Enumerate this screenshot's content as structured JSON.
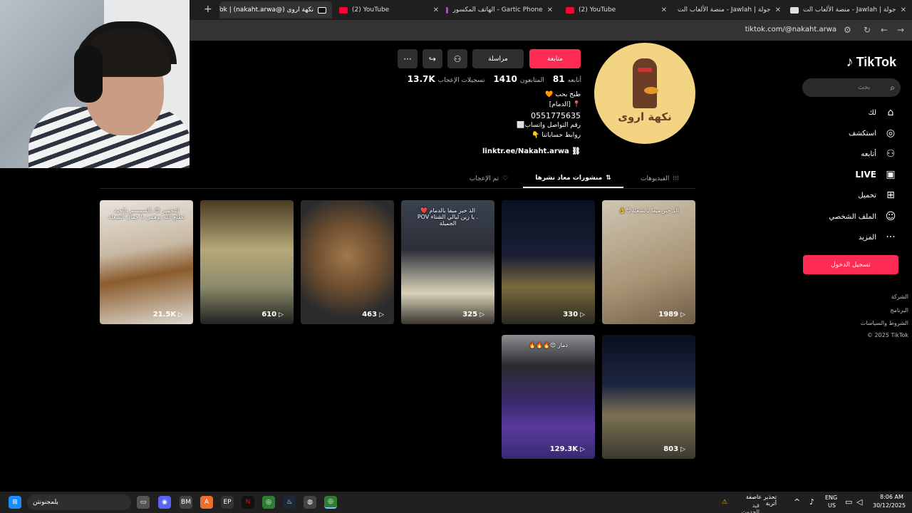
{
  "browser": {
    "tabs": [
      {
        "title": "جولة | Jawlah - منصة الألعاب الت",
        "favicon_color": "#e0e0e0"
      },
      {
        "title": "جولة | Jawlah - منصة الألعاب الت",
        "favicon_color": "#e0e0e0"
      },
      {
        "title": "(2) YouTube",
        "favicon_color": "#ff0033"
      },
      {
        "title": "Gartic Phone - الهاتف المكسور",
        "favicon_color": "#9b59b6"
      },
      {
        "title": "(2) YouTube",
        "favicon_color": "#ff0033"
      },
      {
        "title": "نكهة اروى (@nakaht.arwa) | Tok",
        "favicon_color": "#ffffff"
      }
    ],
    "new_tab": "+",
    "close_glyph": "✕",
    "url": "tiktok.com/@nakaht.arwa"
  },
  "sidebar": {
    "logo": "TikTok",
    "search_placeholder": "بحث",
    "nav": [
      {
        "label": "لك",
        "icon": "home-icon",
        "glyph": "⌂"
      },
      {
        "label": "استكشف",
        "icon": "compass-icon",
        "glyph": "◎"
      },
      {
        "label": "أتابعه",
        "icon": "following-icon",
        "glyph": "⚇"
      },
      {
        "label": "LIVE",
        "icon": "live-icon",
        "glyph": "▣"
      },
      {
        "label": "تحميل",
        "icon": "upload-icon",
        "glyph": "⊞"
      },
      {
        "label": "الملف الشخصي",
        "icon": "profile-icon",
        "glyph": "☺"
      },
      {
        "label": "المزيد",
        "icon": "more-icon",
        "glyph": "···"
      }
    ],
    "login": "تسجيل الدخول",
    "footer": [
      "الشركة",
      "البرنامج",
      "الشروط والسياسات",
      "© 2025 TikTok"
    ]
  },
  "profile": {
    "avatar_text": "نكهة اروى",
    "follow": "متابعة",
    "message": "مراسلة",
    "stats": [
      {
        "num": "81",
        "label": "أتابعه"
      },
      {
        "num": "1410",
        "label": "المتابعون"
      },
      {
        "num": "13.7K",
        "label": "تسجيلات الإعجاب"
      }
    ],
    "bio": [
      "طبخ بحب 🧡",
      "📍 [الدمام]",
      "0551775635",
      "رقم التواصل واتساب⬜",
      "روابط حساباتنا 👇"
    ],
    "link": "linktr.ee/Nakaht.arwa"
  },
  "tabs": [
    {
      "label": "الفيديوهات",
      "glyph": "⁝⁝⁝"
    },
    {
      "label": "منشورات معاد نشرها",
      "glyph": "⇅"
    },
    {
      "label": "تم الإعجاب",
      "glyph": "♡"
    }
  ],
  "videos": [
    {
      "views": "1989",
      "caption": "الذ خبز ميفا بالشعلة😍👌",
      "bg": "linear-gradient(160deg,#cfc6b3,#a89374 60%,#6e5d47)"
    },
    {
      "views": "330",
      "caption": "",
      "bg": "linear-gradient(180deg,#0b1022 0%,#1a1f36 45%,#7a6a3c 70%,#2a2a22)"
    },
    {
      "views": "325",
      "caption": "الذ خبز ميفا بالدمام ❤️\n. يا زين ليالي الشتاء POV\nالجميلة",
      "bg": "linear-gradient(180deg,#3a4250 0%,#2c2f38 40%,#d9d2b8 75%,#3a3530)"
    },
    {
      "views": "463",
      "caption": "",
      "bg": "radial-gradient(circle at 50% 45%,#a1784a 0%,#6d4e30 40%,#2b2b2b 75%)"
    },
    {
      "views": "610",
      "caption": "",
      "bg": "linear-gradient(180deg,#4a3b22 0%,#b7a878 40%,#8a8a6b 70%,#222)"
    },
    {
      "views": "21.5K",
      "caption": "التخمير 😍 بالسمسم والحبة\nتطلع الله يوهمي يا جمال الشعلة",
      "bg": "linear-gradient(170deg,#e8e3dc 0%,#c9b9a4 40%,#8a5c2e 60%,#e0dbd2)"
    },
    {
      "views": "803",
      "caption": "",
      "bg": "linear-gradient(180deg,#0a0f20 0%,#1c2540 40%,#7c7152 65%,#3a3a30)"
    },
    {
      "views": "129.3K",
      "caption": "دمار 😍🔥🔥🔥",
      "bg": "linear-gradient(180deg,#8e8e92 0%,#2a2a2e 25%,#3b2a6e 55%,#5b3a9e 75%,#352a70)"
    }
  ],
  "taskbar": {
    "search_text": "يلمجنونتن",
    "weather_line1": "تحذير عاصفة أتربة",
    "weather_line2": "قيد الحدوث",
    "lang": "ENG",
    "region": "US",
    "time": "8:06 AM",
    "date": "30/12/2025"
  }
}
